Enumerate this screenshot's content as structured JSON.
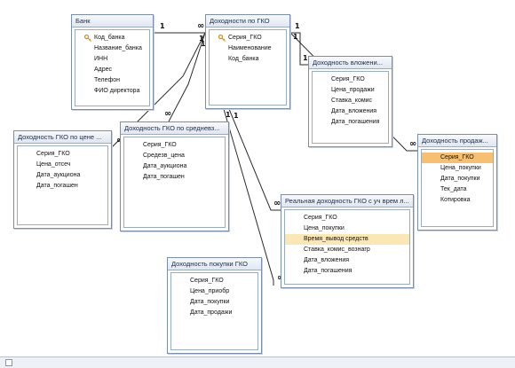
{
  "tables": [
    {
      "id": "bank",
      "title": "Банк",
      "fields": [
        {
          "name": "Код_банка",
          "key": true
        },
        {
          "name": "Название_банка"
        },
        {
          "name": "ИНН"
        },
        {
          "name": "Адрес"
        },
        {
          "name": "Телефон"
        },
        {
          "name": "ФИО директора"
        }
      ]
    },
    {
      "id": "gko",
      "title": "Доходности по ГКО",
      "fields": [
        {
          "name": "Серия_ГКО",
          "key": true
        },
        {
          "name": "Наименование"
        },
        {
          "name": "Код_банка"
        }
      ]
    },
    {
      "id": "vlozh",
      "title": "Доходность вложени...",
      "fields": [
        {
          "name": "Серия_ГКО"
        },
        {
          "name": "Цена_продажи"
        },
        {
          "name": "Ставка_комис"
        },
        {
          "name": "Дата_вложения"
        },
        {
          "name": "Дата_погашения"
        }
      ]
    },
    {
      "id": "prodazh",
      "title": "Доходность продаж...",
      "fields": [
        {
          "name": "Серия_ГКО",
          "highlight": "orange"
        },
        {
          "name": "Цена_покупки"
        },
        {
          "name": "Дата_покупки"
        },
        {
          "name": "Тек_дата"
        },
        {
          "name": "Котировка"
        }
      ]
    },
    {
      "id": "tsene",
      "title": "Доходность ГКО по цене ...",
      "fields": [
        {
          "name": "Серия_ГКО"
        },
        {
          "name": "Цена_отсеч"
        },
        {
          "name": "Дата_аукциона"
        },
        {
          "name": "Дата_погашен"
        }
      ]
    },
    {
      "id": "sredn",
      "title": "Доходность ГКО по средневз...",
      "fields": [
        {
          "name": "Серия_ГКО"
        },
        {
          "name": "Средезв_цена"
        },
        {
          "name": "Дата_аукциона"
        },
        {
          "name": "Дата_погашен"
        }
      ]
    },
    {
      "id": "realn",
      "title": "Реальная доходность ГКО с уч врем л...",
      "fields": [
        {
          "name": "Серия_ГКО"
        },
        {
          "name": "Цена_покупки"
        },
        {
          "name": "Время_вывод средств",
          "highlight": "yellow"
        },
        {
          "name": "Ставка_комис_вознагр"
        },
        {
          "name": "Дата_вложения"
        },
        {
          "name": "Дата_погашения"
        }
      ]
    },
    {
      "id": "pokup",
      "title": "Доходность покупки ГКО",
      "fields": [
        {
          "name": "Серия_ГКО"
        },
        {
          "name": "Цена_приобр"
        },
        {
          "name": "Дата_покупки"
        },
        {
          "name": "Дата_продажи"
        }
      ]
    }
  ],
  "relationships": [
    {
      "from": "bank",
      "to": "gko",
      "from_end": "1",
      "to_end": "∞"
    },
    {
      "from": "gko",
      "to": "vlozh",
      "from_end": "1",
      "to_end": "1"
    },
    {
      "from": "gko",
      "to": "prodazh",
      "from_end": "1",
      "to_end": "∞"
    },
    {
      "from": "gko",
      "to": "tsene",
      "from_end": "1",
      "to_end": "∞"
    },
    {
      "from": "gko",
      "to": "sredn",
      "from_end": "1",
      "to_end": "∞"
    },
    {
      "from": "gko",
      "to": "realn",
      "from_end": "1",
      "to_end": "∞"
    },
    {
      "from": "gko",
      "to": "pokup",
      "from_end": "1",
      "to_end": "∞"
    }
  ],
  "colors": {
    "line": "#2b2b2b",
    "header_border": "#7a8fae",
    "highlight_yellow": "#fbe7b3",
    "highlight_orange": "#f6c070"
  }
}
